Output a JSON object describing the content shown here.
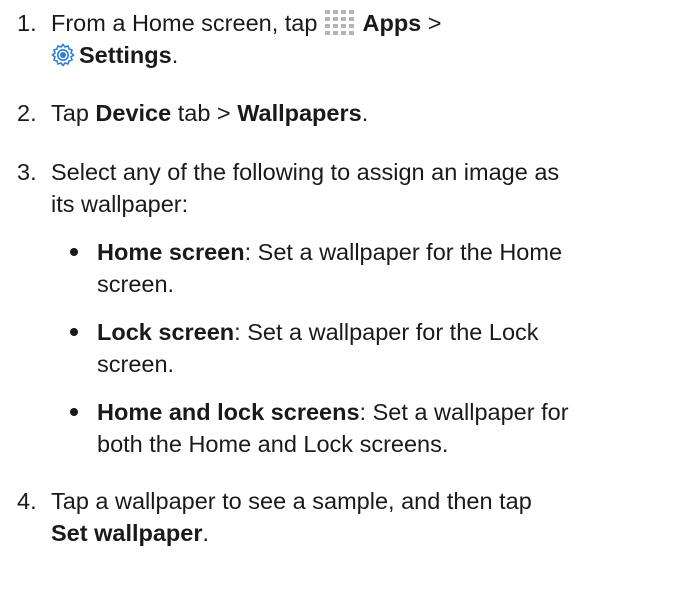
{
  "steps": [
    {
      "number": "1.",
      "pre": "From a Home screen, tap",
      "apps_label": "Apps",
      "sep": ">",
      "settings_label": "Settings",
      "end": ".",
      "icons": [
        "apps-grid-icon",
        "settings-gear-icon"
      ]
    },
    {
      "number": "2.",
      "pre": "Tap",
      "b1": "Device",
      "mid": "tab >",
      "b2": "Wallpapers",
      "end": "."
    },
    {
      "number": "3.",
      "line1": "Select any of the following to assign an image as",
      "line2": "its wallpaper:",
      "bullets": [
        {
          "term": "Home screen",
          "desc_line1": ": Set a wallpaper for the Home",
          "desc_line2": "screen."
        },
        {
          "term": "Lock screen",
          "desc_line1": ": Set a wallpaper for the Lock",
          "desc_line2": "screen."
        },
        {
          "term": "Home and lock screens",
          "desc_line1": ": Set a wallpaper for",
          "desc_line2": "both the Home and Lock screens."
        }
      ]
    },
    {
      "number": "4.",
      "line1": "Tap a wallpaper to see a sample, and then tap",
      "b1": "Set wallpaper",
      "end": "."
    }
  ],
  "colors": {
    "text": "#1a1a1a",
    "apps_icon": "#b5b5b5",
    "settings_icon": "#2a7fd4"
  }
}
